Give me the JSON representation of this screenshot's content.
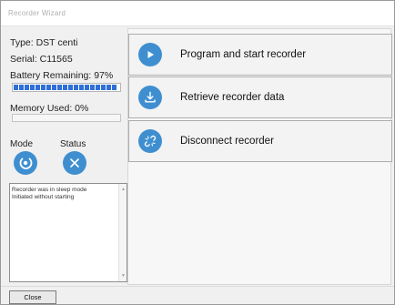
{
  "window": {
    "title": "Recorder Wizard"
  },
  "device": {
    "type_label": "Type: DST centi",
    "serial_label": "Serial: C11565",
    "battery_label": "Battery Remaining: 97%",
    "battery_level_percent": 97,
    "memory_label": "Memory Used: 0%",
    "memory_level_percent": 0
  },
  "indicators": {
    "mode_label": "Mode",
    "status_label": "Status",
    "mode_icon": "sleep-mode-icon",
    "status_icon": "x-icon"
  },
  "log": {
    "lines": [
      "Recorder was in sleep mode",
      "Initiated without starting"
    ]
  },
  "actions": {
    "program": {
      "label": "Program and start recorder",
      "icon": "play-icon"
    },
    "retrieve": {
      "label": "Retrieve recorder data",
      "icon": "download-icon"
    },
    "disconnect": {
      "label": "Disconnect recorder",
      "icon": "disconnect-icon"
    }
  },
  "footer": {
    "close_label": "Close"
  },
  "colors": {
    "accent_icon": "#3f8fd0",
    "battery_fill": "#2f6fd6",
    "window_bg": "#f0f0f0"
  }
}
